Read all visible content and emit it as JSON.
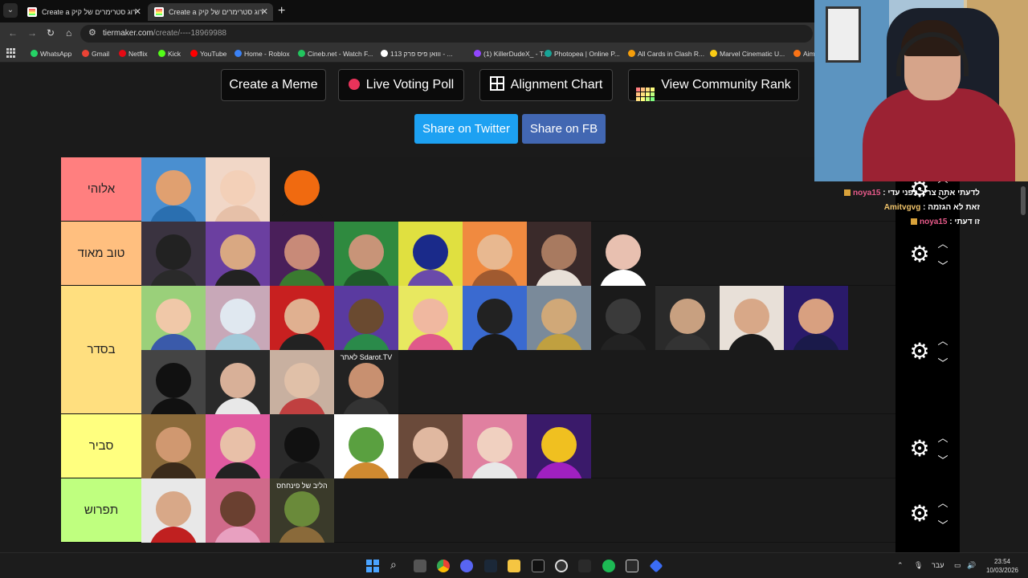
{
  "browser": {
    "tabs": [
      {
        "label": "Create a ירוג סטרימרים של קיק"
      },
      {
        "label": "Create a ירוג סטרימרים של קיק"
      }
    ],
    "new_tab": "+",
    "url_host": "tiermaker.com",
    "url_path": "/create/----18969988",
    "bookmarks": [
      {
        "label": "WhatsApp",
        "color": "#25d366"
      },
      {
        "label": "Gmail",
        "color": "#ea4335"
      },
      {
        "label": "Netflix",
        "color": "#e50914"
      },
      {
        "label": "Kick",
        "color": "#53fc18"
      },
      {
        "label": "YouTube",
        "color": "#ff0000"
      },
      {
        "label": "Home - Roblox",
        "color": "#3b82f6"
      },
      {
        "label": "Cineb.net - Watch F...",
        "color": "#22c55e"
      },
      {
        "label": "ווואן פיס פרק 113 - ...",
        "color": "#ffffff"
      },
      {
        "label": "(1) KillerDudeX_ - T...",
        "color": "#9146ff"
      },
      {
        "label": "Photopea | Online P...",
        "color": "#18a497"
      },
      {
        "label": "All Cards in Clash R...",
        "color": "#f59e0b"
      },
      {
        "label": "Marvel Cinematic U...",
        "color": "#facc15"
      },
      {
        "label": "Aim",
        "color": "#f97316"
      }
    ]
  },
  "actions": {
    "create_meme": "Create a Meme",
    "live_voting": "Live Voting Poll",
    "alignment_chart": "Alignment Chart",
    "community_rank": "View Community Rank",
    "share_twitter": "Share on Twitter",
    "share_fb": "Share on FB"
  },
  "colors": {
    "twitter": "#1da1f2",
    "facebook": "#4267b2",
    "tier_s": "#ff7f7f",
    "tier_a": "#ffbf7f",
    "tier_b": "#ffdf7f",
    "tier_c": "#ffff7f",
    "tier_d": "#bfff7f"
  },
  "tiers": [
    {
      "label": "אלוהי",
      "color": "#ff7f7f",
      "items": [
        {
          "bg": "#4a8fd0",
          "face": "#e0a070",
          "body": "#2a6fb0"
        },
        {
          "bg": "#f1d7c7",
          "face": "#f3d0b8",
          "body": "#e6c0a8"
        },
        {
          "bg": "#1a1a1a",
          "face": "#f06a10",
          "body": "#1a1a1a"
        }
      ]
    },
    {
      "label": "טוב מאוד",
      "color": "#ffbf7f",
      "items": [
        {
          "bg": "#3a3340",
          "face": "#222222",
          "body": "#2a2a2a"
        },
        {
          "bg": "#6b3fa0",
          "face": "#d9a882",
          "body": "#222222"
        },
        {
          "bg": "#4a1f5a",
          "face": "#c88a78",
          "body": "#3a7a30"
        },
        {
          "bg": "#2f8a3f",
          "face": "#c89478",
          "body": "#1f5a2a"
        },
        {
          "bg": "#e0e040",
          "face": "#1a2a8a",
          "body": "#6a4aaa"
        },
        {
          "bg": "#f08a40",
          "face": "#e8b890",
          "body": "#a05a30"
        },
        {
          "bg": "#3a2a2a",
          "face": "#a87a60",
          "body": "#e8e0d8"
        },
        {
          "bg": "#1a1a1a",
          "face": "#e8c0b0",
          "body": "#ffffff"
        }
      ]
    },
    {
      "label": "בסדר",
      "color": "#ffdf7f",
      "items": [
        {
          "bg": "#9ad07a",
          "face": "#f0c8a8",
          "body": "#3a5aaa"
        },
        {
          "bg": "#c8a8b8",
          "face": "#e0e8f0",
          "body": "#a0c8d8"
        },
        {
          "bg": "#c82020",
          "face": "#e0b090",
          "body": "#222222"
        },
        {
          "bg": "#5a3aa0",
          "face": "#6a4a30",
          "body": "#2a8a4a"
        },
        {
          "bg": "#e8e860",
          "face": "#f0b8a0",
          "body": "#e05a8a"
        },
        {
          "bg": "#3a6ad0",
          "face": "#222222",
          "body": "#1a1a1a"
        },
        {
          "bg": "#7a8a9a",
          "face": "#d0a878",
          "body": "#c0a040"
        },
        {
          "bg": "#1a1a1a",
          "face": "#3a3a3a",
          "body": "#222222"
        },
        {
          "bg": "#2a2a2a",
          "face": "#c8a080",
          "body": "#333333"
        },
        {
          "bg": "#e8e0d8",
          "face": "#d8a888",
          "body": "#1a1a1a"
        },
        {
          "bg": "#2a1a6a",
          "face": "#d8a080",
          "body": "#1a1a4a"
        },
        {
          "bg": "#444444",
          "face": "#111111",
          "body": "#111111"
        },
        {
          "bg": "#2a2a2a",
          "face": "#d8b098",
          "body": "#e8e8e8"
        },
        {
          "bg": "#c8b0a0",
          "face": "#e0c0a8",
          "body": "#c04040"
        },
        {
          "bg": "#222222",
          "face": "#c89070",
          "body": "#333333",
          "caption": "Sdarot.TV לאתר"
        }
      ]
    },
    {
      "label": "סביר",
      "color": "#ffff7f",
      "items": [
        {
          "bg": "#8a6a3a",
          "face": "#d09870",
          "body": "#3a2a1a"
        },
        {
          "bg": "#e05aa0",
          "face": "#e8c0a8",
          "body": "#222222"
        },
        {
          "bg": "#2a2a2a",
          "face": "#111111",
          "body": "#1a1a1a"
        },
        {
          "bg": "#ffffff",
          "face": "#5aa040",
          "body": "#d08a30"
        },
        {
          "bg": "#6a4a3a",
          "face": "#e0b8a0",
          "body": "#111111"
        },
        {
          "bg": "#e080a0",
          "face": "#f0d0c0",
          "body": "#e8e8e8"
        },
        {
          "bg": "#3a1a6a",
          "face": "#f0c020",
          "body": "#a020c0"
        }
      ]
    },
    {
      "label": "תפרוש",
      "color": "#bfff7f",
      "items": [
        {
          "bg": "#e8e8e8",
          "face": "#d8a888",
          "body": "#c02020"
        },
        {
          "bg": "#d06a8a",
          "face": "#6a4030",
          "body": "#e8a0c0"
        },
        {
          "bg": "#3a3a2a",
          "face": "#6a8a3a",
          "body": "#8a6a3a",
          "caption": "הליב של פינחחס"
        }
      ]
    }
  ],
  "chat": [
    {
      "user": "noya15",
      "text": "לדעתי אתה צריך לפני עדי :"
    },
    {
      "user": "Amitvgvg",
      "text": "זאת לא הגזמה :"
    },
    {
      "user": "noya15",
      "text": "זו דעתי :"
    }
  ],
  "taskbar": {
    "lang": "עבר",
    "time": "23:54",
    "date": "10/03/2026"
  }
}
